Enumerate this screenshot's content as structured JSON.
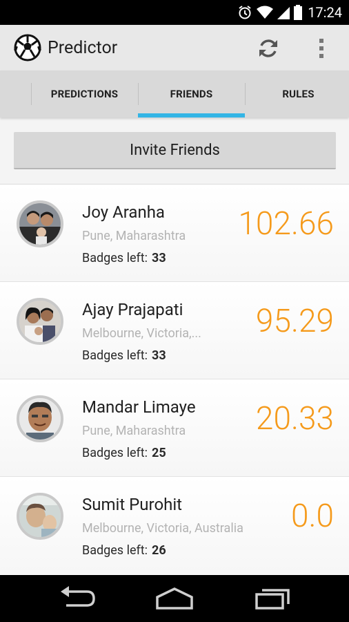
{
  "status_bar": {
    "time": "17:24"
  },
  "app": {
    "title": "Predictor"
  },
  "tabs": [
    {
      "label": "PREDICTIONS"
    },
    {
      "label": "FRIENDS"
    },
    {
      "label": "RULES"
    }
  ],
  "active_tab": "FRIENDS",
  "invite_button": "Invite Friends",
  "badges_label": "Badges left:",
  "friends": [
    {
      "name": "Joy Aranha",
      "location": "Pune, Maharashtra",
      "badges": "33",
      "score": "102.66"
    },
    {
      "name": "Ajay Prajapati",
      "location": "Melbourne, Victoria,...",
      "badges": "33",
      "score": "95.29"
    },
    {
      "name": "Mandar Limaye",
      "location": "Pune, Maharashtra",
      "badges": "25",
      "score": "20.33"
    },
    {
      "name": "Sumit Purohit",
      "location": "Melbourne, Victoria, Australia",
      "badges": "26",
      "score": "0.0"
    }
  ],
  "colors": {
    "accent": "#33b5e5",
    "score": "#f59a1b"
  },
  "icons": [
    "alarm-icon",
    "wifi-icon",
    "signal-icon",
    "battery-icon",
    "soccer-ball-icon",
    "refresh-icon",
    "overflow-menu-icon",
    "back-icon",
    "home-icon",
    "recent-apps-icon"
  ]
}
